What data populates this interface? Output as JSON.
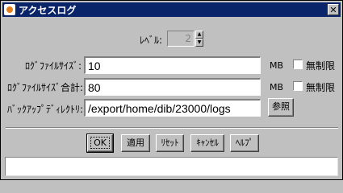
{
  "window": {
    "title": "アクセスログ",
    "close_symbol": "✕"
  },
  "level": {
    "label": "ﾚﾍﾞﾙ:",
    "value": "2",
    "up_symbol": "▲",
    "down_symbol": "▼"
  },
  "file_size": {
    "label": "ﾛｸﾞﾌｧｲﾙｻｲｽﾞ:",
    "value": "10",
    "unit": "MB",
    "unlimited_label": "無制限"
  },
  "file_size_total": {
    "label": "ﾛｸﾞﾌｧｲﾙｻｲｽﾞ合計:",
    "value": "80",
    "unit": "MB",
    "unlimited_label": "無制限"
  },
  "backup_dir": {
    "label": "ﾊﾞｯｸｱｯﾌﾟﾃﾞｨﾚｸﾄﾘ:",
    "value": "/export/home/dib/23000/logs",
    "browse_label": "参照"
  },
  "buttons": {
    "ok": "OK",
    "apply": "適用",
    "reset": "ﾘｾｯﾄ",
    "cancel": "ｷｬﾝｾﾙ",
    "help": "ﾍﾙﾌﾟ"
  },
  "status": {
    "text": ""
  }
}
